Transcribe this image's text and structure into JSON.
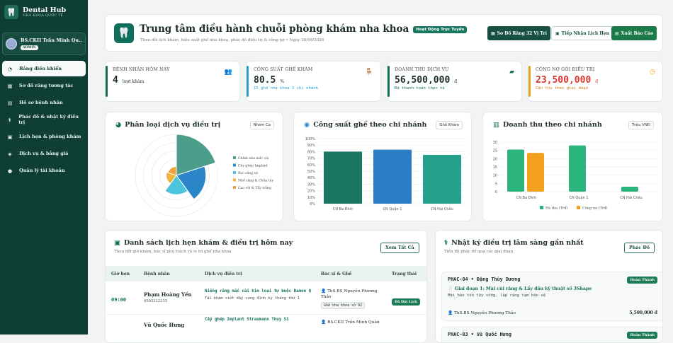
{
  "sidebar": {
    "brand_name": "Dental Hub",
    "brand_sub": "NHA KHOA QUỐC TẾ",
    "user_name": "BS.CKII Trần Minh Qu...",
    "user_role": "ADMIN",
    "items": [
      {
        "label": "Bảng điều khiển",
        "icon": "dashboard-icon"
      },
      {
        "label": "Sơ đồ răng tương tác",
        "icon": "tooth-chart-icon"
      },
      {
        "label": "Hồ sơ bệnh nhân",
        "icon": "folder-icon"
      },
      {
        "label": "Phác đồ & nhật ký điều trị",
        "icon": "treatment-icon"
      },
      {
        "label": "Lịch hẹn & phòng khám",
        "icon": "calendar-icon"
      },
      {
        "label": "Dịch vụ & bảng giá",
        "icon": "price-tag-icon"
      },
      {
        "label": "Quản lý tài khoản",
        "icon": "user-icon"
      }
    ]
  },
  "header": {
    "title": "Trung tâm điều hành chuỗi phòng khám nha khoa",
    "badge": "Hoạt Động Trực Tuyến",
    "subtitle": "Theo dõi lịch khám, hiệu suất ghế nha khoa, phác đồ điều trị & công nợ • Ngày 26/08/2026",
    "btn_tooth_map": "Sơ Đồ Răng 32 Vị Trí",
    "btn_appointment": "Tiếp Nhận Lịch Hẹn",
    "btn_report": "Xuất Báo Cáo"
  },
  "stats": [
    {
      "label": "BỆNH NHÂN HÔM NAY",
      "value": "4",
      "unit": "lượt khám",
      "foot": "",
      "color": "#12705c"
    },
    {
      "label": "CÔNG SUẤT GHẾ KHÁM",
      "value": "80.5",
      "unit": "%",
      "foot": "15 ghế nha khoa 3 chi nhánh",
      "color": "#2a9fd6"
    },
    {
      "label": "DOANH THU DỊCH VỤ",
      "value": "56,500,000",
      "unit": "đ",
      "foot": "Đã thanh toán thực tế",
      "color": "#12705c"
    },
    {
      "label": "CÔNG NỢ GÓI ĐIỀU TRỊ",
      "value": "23,500,000",
      "unit": "đ",
      "foot": "Cần thu theo giai đoạn",
      "color": "#f0a020"
    }
  ],
  "charts": {
    "service_title": "Phân loại dịch vụ điều trị",
    "service_tag": "Nhóm Ca",
    "capacity_title": "Công suất ghế theo chi nhánh",
    "capacity_tag": "Ghế Khám",
    "revenue_title": "Doanh thu theo chi nhánh",
    "revenue_tag": "Triệu VNĐ"
  },
  "chart_data": [
    {
      "type": "polar-area",
      "categories": [
        "Chỉnh nha mắc cài",
        "Cấy ghép Implant",
        "Bọc răng sứ",
        "Nhổ răng & Chữa tủy",
        "Cạo vôi & Tẩy trắng"
      ],
      "values": [
        3.2,
        2.3,
        1.5,
        0.8,
        0.7
      ],
      "colors": [
        "#4a9e8a",
        "#2a86c9",
        "#4cc4dd",
        "#f2b53a",
        "#f2a23a"
      ]
    },
    {
      "type": "bar",
      "categories": [
        "CN Ba Đình",
        "CN Quận 1",
        "CN Hải Châu"
      ],
      "values": [
        80,
        83,
        75
      ],
      "ylim": [
        0,
        100
      ],
      "ytick_suffix": "%",
      "colors": [
        "#1b7563",
        "#2a7ec4",
        "#25a08a"
      ]
    },
    {
      "type": "bar",
      "categories": [
        "CN Ba Đình",
        "CN Quận 1",
        "CN Hải Châu"
      ],
      "series": [
        {
          "name": "Đã thu (Trđ)",
          "values": [
            25.5,
            28,
            3
          ],
          "color": "#2bb47c"
        },
        {
          "name": "Công nợ (Trđ)",
          "values": [
            23.5,
            0,
            0
          ],
          "color": "#f2a01e"
        }
      ],
      "ylim": [
        0,
        30
      ],
      "legend": "bottom"
    }
  ],
  "appointments": {
    "title": "Danh sách lịch hẹn khám & điều trị hôm nay",
    "subtitle": "Theo dõi giờ khám, bác sĩ phụ trách và vị trí ghế nha khoa",
    "view_all": "Xem Tất Cả",
    "columns": [
      "Giờ hẹn",
      "Bệnh nhân",
      "Dịch vụ điều trị",
      "Bác sĩ & Ghế",
      "Trạng thái"
    ],
    "rows": [
      {
        "time": "09:00",
        "patient": "Phạm Hoàng Yến",
        "phone": "0903112233",
        "service": "Niềng răng mắc cài kim loại tự buộc Damon Q",
        "note": "Tái khám siết dây cung định kỳ tháng thứ 1",
        "doctor": "ThS.BS Nguyễn Phương Thảo",
        "chair": "Ghế nha khoa số 02",
        "status": "Đã Đặt Lịch"
      },
      {
        "time": "",
        "patient": "Vũ Quốc Hưng",
        "phone": "",
        "service": "Cấy ghép Implant Straumann Thụy Sĩ",
        "note": "",
        "doctor": "BS.CKII Trần Minh Quân",
        "chair": "",
        "status": ""
      }
    ]
  },
  "logs": {
    "title": "Nhật ký điều trị lâm sàng gần nhất",
    "subtitle": "Tiến độ phác đồ qua các giai đoạn",
    "btn": "Phác Đồ",
    "items": [
      {
        "code": "PHAC-04 • Đặng Thùy Dương",
        "status": "Hoàn Thành",
        "stage": "Giai đoạn 1: Mài cùi răng & Lấy dấu kỹ thuật số 3Shape",
        "desc": "Mài bảo tồn tủy sống, lắp răng tạm bảo vệ",
        "doctor": "ThS.BS Nguyễn Phương Thảo",
        "amount": "5,500,000 đ"
      },
      {
        "code": "PHAC-03 • Vũ Quốc Hưng",
        "status": "Hoàn Thành",
        "stage": "",
        "desc": "",
        "doctor": "",
        "amount": ""
      }
    ]
  }
}
